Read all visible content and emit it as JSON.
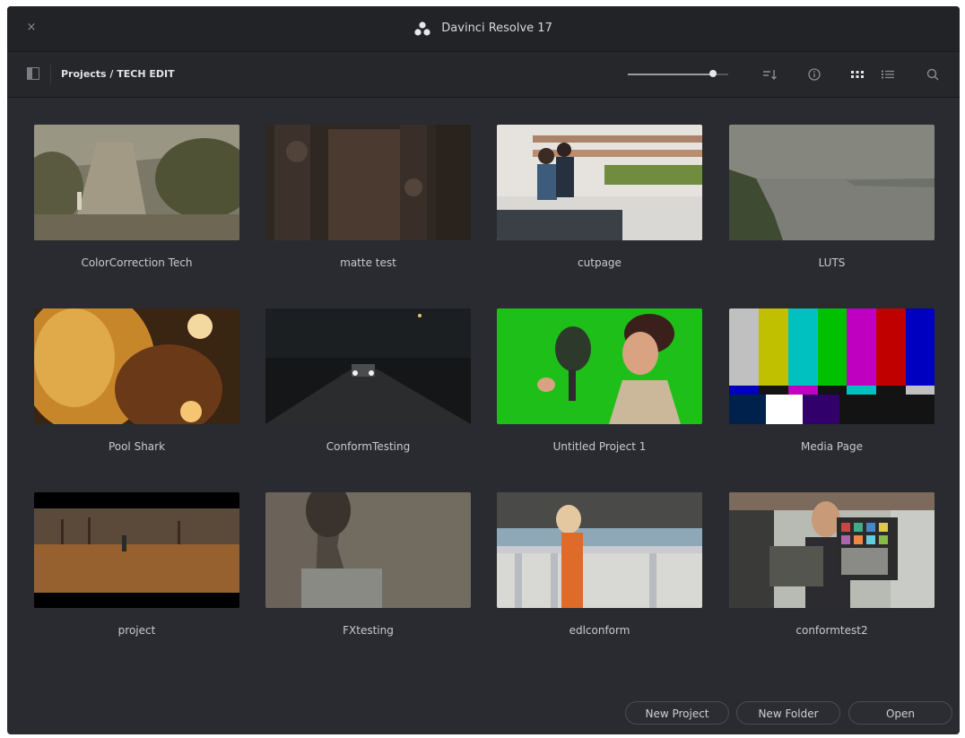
{
  "window": {
    "title": "Davinci Resolve 17",
    "close_glyph": "×"
  },
  "toolbar": {
    "breadcrumb": "Projects / TECH EDIT",
    "thumbnail_size_level": 0.85,
    "icons": [
      "sidebar-toggle-icon",
      "sort-icon",
      "info-icon",
      "grid-view-icon",
      "list-view-icon",
      "search-icon"
    ]
  },
  "projects": [
    {
      "name": "ColorCorrection Tech"
    },
    {
      "name": "matte test"
    },
    {
      "name": "cutpage"
    },
    {
      "name": "LUTS"
    },
    {
      "name": "Pool Shark"
    },
    {
      "name": "ConformTesting"
    },
    {
      "name": "Untitled Project 1"
    },
    {
      "name": "Media Page"
    },
    {
      "name": "project"
    },
    {
      "name": "FXtesting"
    },
    {
      "name": "edlconform"
    },
    {
      "name": "conformtest2"
    }
  ],
  "footer": {
    "new_project": "New Project",
    "new_folder": "New Folder",
    "open": "Open"
  },
  "colors": {
    "window_bg": "#2a2b30",
    "titlebar_bg": "#222327",
    "text_primary": "#e2e2e6"
  }
}
